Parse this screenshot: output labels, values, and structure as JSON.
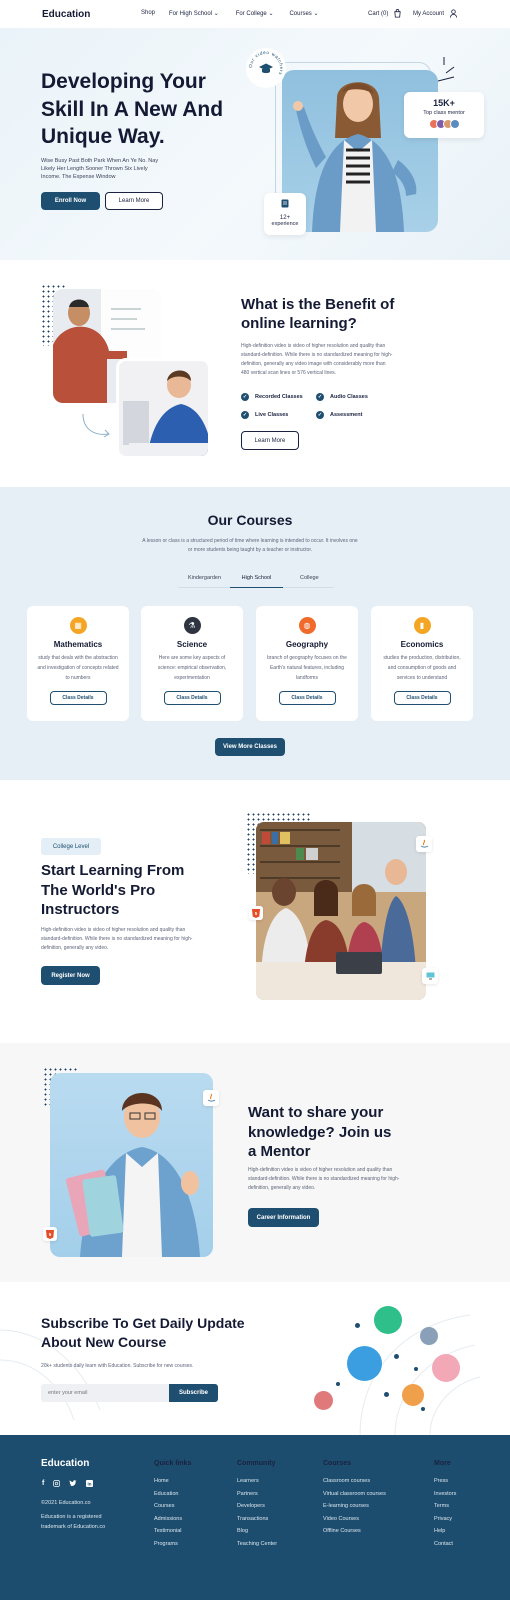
{
  "header": {
    "logo": "Education",
    "nav": [
      "Shop",
      "For High School",
      "For College",
      "Courses"
    ],
    "cart": "Cart (0)",
    "account": "My Account"
  },
  "hero": {
    "title_line1": "Developing Your",
    "title_line2": "Skill In A New And",
    "title_line3": "Unique Way.",
    "desc_line1": "Wise Busy Past Both Park When An Ye No. Nay",
    "desc_line2": "Likely Her Length Sooner Thrown Six Lively",
    "desc_line3": "Income. The Expense Window",
    "enroll_btn": "Enroll Now",
    "learn_btn": "Learn More",
    "badge_ring": "Our video watchers",
    "mentor_count": "15K+",
    "mentor_label": "Top class mentor",
    "experience_num": "12+",
    "experience_label": "experience"
  },
  "benefit": {
    "title_line1": "What is the Benefit of",
    "title_line2": "online learning?",
    "desc_line1": "High-definition video is video of higher resolution and quality than",
    "desc_line2": "standard-definition. While there is no standardized meaning for high-",
    "desc_line3": "definition, generally any video image with considerably more than",
    "desc_line4": "480 vertical scan lines or 576 vertical lines.",
    "features": [
      "Recorded Classes",
      "Audio Classes",
      "Live Classes",
      "Assessment"
    ],
    "learn_btn": "Learn More"
  },
  "courses": {
    "title": "Our Courses",
    "desc_line1": "A lesson or class is a structured period of time where learning is intended to occur. It involves one",
    "desc_line2": "or more students being taught by a teacher or instructor.",
    "tabs": [
      "Kindergarden",
      "High School",
      "College"
    ],
    "active_tab": "High School",
    "cards": [
      {
        "title": "Mathematics",
        "d1": "study that deals with the abstraction",
        "d2": "and investigation of concepts related",
        "d3": "to numbers",
        "btn": "Class Details",
        "color": "#f5a524"
      },
      {
        "title": "Science",
        "d1": "Here are some key aspects of",
        "d2": "science: empirical observation,",
        "d3": "experimentation",
        "btn": "Class Details",
        "color": "#2e3440"
      },
      {
        "title": "Geography",
        "d1": "branch of geography focuses on the",
        "d2": "Earth's natural features, including",
        "d3": "landforms",
        "btn": "Class Details",
        "color": "#f06a2c"
      },
      {
        "title": "Economics",
        "d1": "studies the production, distribution,",
        "d2": "and consumption of goods and",
        "d3": "services to understand",
        "btn": "Class Details",
        "color": "#f5a524"
      }
    ],
    "more_btn": "View More Classes"
  },
  "instructors": {
    "tag": "College Level",
    "title_line1": "Start Learning From",
    "title_line2": "The World's Pro",
    "title_line3": "Instructors",
    "desc_line1": "High-definition video is video of higher resolution and quality than",
    "desc_line2": "standard-definition. While there is no standardized meaning for high-",
    "desc_line3": "definition, generally any video.",
    "btn": "Register Now"
  },
  "mentor": {
    "title_line1": "Want to share your",
    "title_line2": "knowledge? Join us",
    "title_line3": "a Mentor",
    "desc_line1": "High-definition video is video of higher resolution and quality than",
    "desc_line2": "standard-definition. While there is no standardized meaning for high-",
    "desc_line3": "definition, generally any video.",
    "btn": "Career Information"
  },
  "subscribe": {
    "title_line1": "Subscribe To Get Daily Update",
    "title_line2": "About New Course",
    "desc": "20k+ students daily learn with Education. Subscribe for new courses.",
    "placeholder": "enter your email",
    "btn": "Subscribe"
  },
  "footer": {
    "logo": "Education",
    "copyright": "©2021 Education.co",
    "trademark_line1": "Education is a registered",
    "trademark_line2": "trademark of Education.co",
    "quick_links": {
      "title": "Quick links",
      "items": [
        "Home",
        "Education",
        "Courses",
        "Admissions",
        "Testimonial",
        "Programs"
      ]
    },
    "community": {
      "title": "Community",
      "items": [
        "Learners",
        "Partners",
        "Developers",
        "Transactions",
        "Blog",
        "Teaching Center"
      ]
    },
    "courses": {
      "title": "Courses",
      "items": [
        "Classroom courses",
        "Virtual classroom courses",
        "E-learning courses",
        "Video Courses",
        "Offline Courses"
      ]
    },
    "more": {
      "title": "More",
      "items": [
        "Press",
        "Investors",
        "Terms",
        "Privacy",
        "Help",
        "Contact"
      ]
    }
  }
}
